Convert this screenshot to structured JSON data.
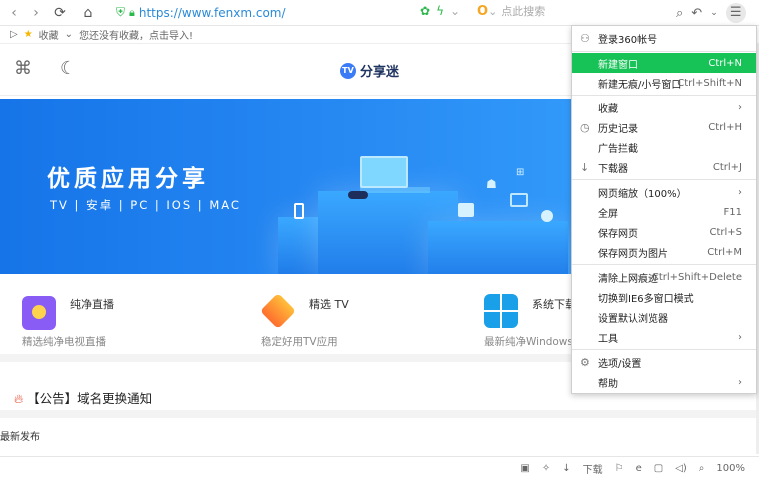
{
  "toolbar": {
    "url": "https://www.fenxm.com/",
    "search_placeholder": "点此搜索"
  },
  "favbar": {
    "fav_label": "收藏",
    "empty_hint": "您还没有收藏，点击导入!"
  },
  "header": {
    "logo_text": "分享迷"
  },
  "banner": {
    "title": "优质应用分享",
    "subtitle": "TV | 安卓 | PC | IOS | MAC"
  },
  "apps": [
    {
      "title": "纯净直播",
      "desc": "精选纯净电视直播"
    },
    {
      "title": "精选 TV",
      "desc": "稳定好用TV应用"
    },
    {
      "title": "系统下载",
      "desc": "最新纯净Windows"
    }
  ],
  "notice": {
    "text": "【公告】域名更换通知"
  },
  "latest": "最新发布",
  "statusbar": {
    "download": "下载",
    "zoom": "100%"
  },
  "menu": {
    "login": "登录360帐号",
    "items": [
      {
        "label": "新建窗口",
        "shortcut": "Ctrl+N"
      },
      {
        "label": "新建无痕/小号窗口",
        "shortcut": "Ctrl+Shift+N"
      },
      {
        "label": "收藏",
        "shortcut": "›"
      },
      {
        "label": "历史记录",
        "shortcut": "Ctrl+H"
      },
      {
        "label": "广告拦截",
        "shortcut": ""
      },
      {
        "label": "下载器",
        "shortcut": "Ctrl+J"
      },
      {
        "label": "网页缩放（100%）",
        "shortcut": "›"
      },
      {
        "label": "全屏",
        "shortcut": "F11"
      },
      {
        "label": "保存网页",
        "shortcut": "Ctrl+S"
      },
      {
        "label": "保存网页为图片",
        "shortcut": "Ctrl+M"
      },
      {
        "label": "清除上网痕迹",
        "shortcut": "Ctrl+Shift+Delete"
      },
      {
        "label": "切换到IE6多窗口模式",
        "shortcut": ""
      },
      {
        "label": "设置默认浏览器",
        "shortcut": ""
      },
      {
        "label": "工具",
        "shortcut": "›"
      },
      {
        "label": "选项/设置",
        "shortcut": ""
      },
      {
        "label": "帮助",
        "shortcut": "›"
      }
    ]
  },
  "colors": {
    "highlight": "#17c257",
    "banner": "#1f82ee",
    "link": "#2a8ad8"
  }
}
